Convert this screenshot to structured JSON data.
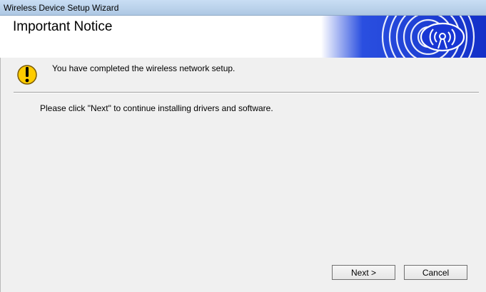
{
  "window": {
    "title": "Wireless Device Setup Wizard"
  },
  "header": {
    "title": "Important Notice",
    "logo_icon": "wireless-signal-logo"
  },
  "content": {
    "warning_icon": "warning-exclamation-icon",
    "message": "You have completed the wireless network setup.",
    "instruction": "Please click \"Next\" to continue installing drivers and software."
  },
  "buttons": {
    "next_label": "Next >",
    "cancel_label": "Cancel"
  },
  "colors": {
    "logo_blue": "#1a3fd0",
    "warning_yellow": "#ffcc00",
    "title_bar": "#b9d1ea"
  }
}
